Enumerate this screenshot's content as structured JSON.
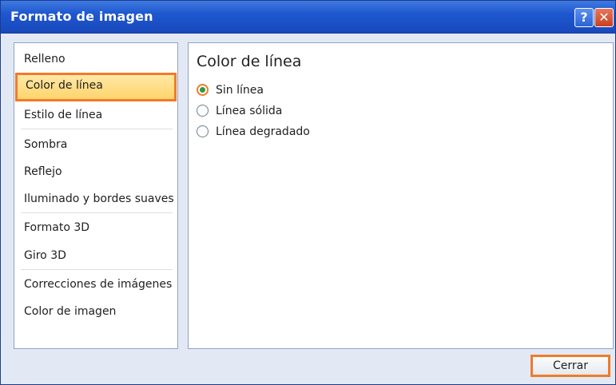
{
  "window": {
    "title": "Formato de imagen",
    "help_label": "?",
    "close_label": "✕",
    "titlebar_color": "#1f57d0"
  },
  "nav": {
    "items": [
      {
        "label": "Relleno"
      },
      {
        "label": "Color de línea",
        "selected": true
      },
      {
        "label": "Estilo de línea"
      },
      {
        "label": "Sombra"
      },
      {
        "label": "Reflejo"
      },
      {
        "label": "Iluminado y bordes suaves"
      },
      {
        "label": "Formato 3D"
      },
      {
        "label": "Giro 3D"
      },
      {
        "label": "Correcciones de imágenes"
      },
      {
        "label": "Color de imagen"
      }
    ],
    "highlight_color": "#f07b2a"
  },
  "content": {
    "section_title": "Color de línea",
    "options": [
      {
        "label": "Sin línea",
        "checked": true
      },
      {
        "label": "Línea sólida",
        "checked": false
      },
      {
        "label": "Línea degradado",
        "checked": false
      }
    ]
  },
  "footer": {
    "close_button_label": "Cerrar"
  }
}
